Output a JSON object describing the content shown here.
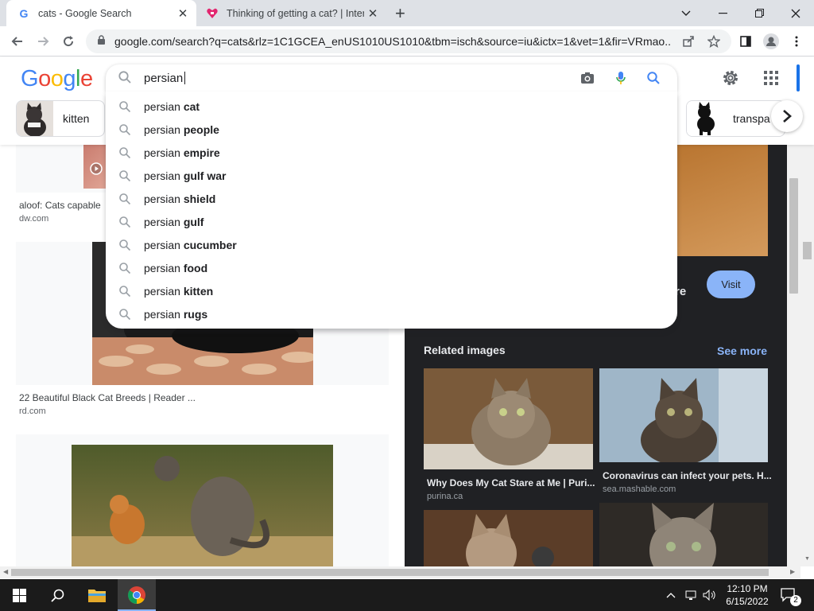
{
  "browser": {
    "tabs": [
      {
        "title": "cats - Google Search",
        "close": "✕"
      },
      {
        "title": "Thinking of getting a cat? | Intern",
        "close": "✕"
      }
    ],
    "new_tab": "+",
    "url": "google.com/search?q=cats&rlz=1C1GCEA_enUS1010US1010&tbm=isch&source=iu&ictx=1&vet=1&fir=VRmao..."
  },
  "google": {
    "logo_letters": [
      {
        "ch": "G",
        "color": "#4285F4"
      },
      {
        "ch": "o",
        "color": "#EA4335"
      },
      {
        "ch": "o",
        "color": "#FBBC05"
      },
      {
        "ch": "g",
        "color": "#4285F4"
      },
      {
        "ch": "l",
        "color": "#34A853"
      },
      {
        "ch": "e",
        "color": "#EA4335"
      }
    ],
    "query": "persian",
    "chips": [
      {
        "label": "kitten"
      },
      {
        "label": "transpa"
      }
    ]
  },
  "suggestions": [
    {
      "prefix": "persian ",
      "completion": "cat"
    },
    {
      "prefix": "persian ",
      "completion": "people"
    },
    {
      "prefix": "persian ",
      "completion": "empire"
    },
    {
      "prefix": "persian ",
      "completion": "gulf war"
    },
    {
      "prefix": "persian ",
      "completion": "shield"
    },
    {
      "prefix": "persian ",
      "completion": "gulf"
    },
    {
      "prefix": "persian ",
      "completion": "cucumber"
    },
    {
      "prefix": "persian ",
      "completion": "food"
    },
    {
      "prefix": "persian ",
      "completion": "kitten"
    },
    {
      "prefix": "persian ",
      "completion": "rugs"
    }
  ],
  "results": [
    {
      "title": "aloof: Cats capable",
      "source": "dw.com"
    },
    {
      "title": "22 Beautiful Black Cat Breeds | Reader ...",
      "source": "rd.com"
    }
  ],
  "panel": {
    "partial_text": "re",
    "visit_label": "Visit",
    "related_title": "Related images",
    "see_more": "See more",
    "related": [
      {
        "caption": "Why Does My Cat Stare at Me | Puri...",
        "source": "purina.ca"
      },
      {
        "caption": "Coronavirus can infect your pets. H...",
        "source": "sea.mashable.com"
      }
    ]
  },
  "taskbar": {
    "time": "12:10 PM",
    "date": "6/15/2022",
    "notifications": "2"
  },
  "colors": {
    "accent": "#1a73e8",
    "panel_bg": "#202124",
    "link_blue": "#8ab4f8"
  }
}
